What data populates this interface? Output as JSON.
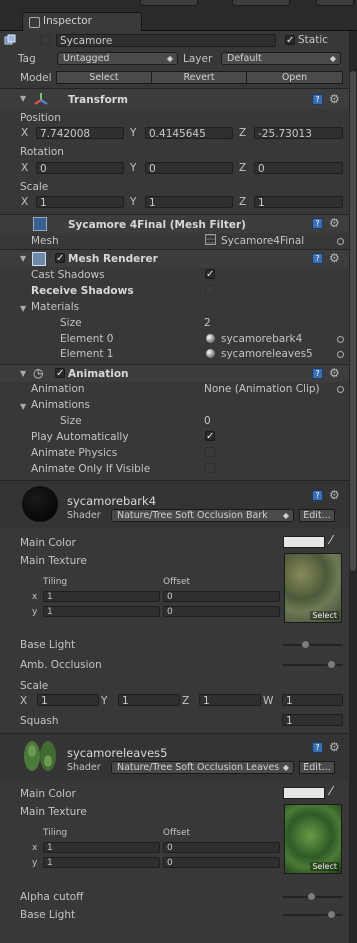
{
  "tab": {
    "title": "Inspector"
  },
  "object": {
    "name": "Sycamore",
    "static_label": "Static",
    "static_checked": true,
    "tag_label": "Tag",
    "tag_value": "Untagged",
    "layer_label": "Layer",
    "layer_value": "Default",
    "model_label": "Model",
    "model_select": "Select",
    "model_revert": "Revert",
    "model_open": "Open"
  },
  "transform": {
    "title": "Transform",
    "position_label": "Position",
    "rotation_label": "Rotation",
    "scale_label": "Scale",
    "axis_x": "X",
    "axis_y": "Y",
    "axis_z": "Z",
    "position": {
      "x": "7.742008",
      "y": "0.4145645",
      "z": "-25.73013"
    },
    "rotation": {
      "x": "0",
      "y": "0",
      "z": "0"
    },
    "scale": {
      "x": "1",
      "y": "1",
      "z": "1"
    }
  },
  "mesh_filter": {
    "title": "Sycamore 4Final (Mesh Filter)",
    "mesh_label": "Mesh",
    "mesh_value": "Sycamore4Final"
  },
  "mesh_renderer": {
    "title": "Mesh Renderer",
    "cast_shadows": "Cast Shadows",
    "receive_shadows": "Receive Shadows",
    "materials": "Materials",
    "size_label": "Size",
    "size": "2",
    "element0_label": "Element 0",
    "element0": "sycamorebark4",
    "element1_label": "Element 1",
    "element1": "sycamoreleaves5"
  },
  "animation": {
    "title": "Animation",
    "animation_label": "Animation",
    "animation_value": "None (Animation Clip)",
    "animations": "Animations",
    "size_label": "Size",
    "size": "0",
    "play_auto": "Play Automatically",
    "animate_physics": "Animate Physics",
    "animate_visible": "Animate Only If Visible"
  },
  "mat1": {
    "name": "sycamorebark4",
    "shader_label": "Shader",
    "shader": "Nature/Tree Soft Occlusion Bark",
    "edit": "Edit...",
    "main_color": "Main Color",
    "main_texture": "Main Texture",
    "tiling": "Tiling",
    "offset": "Offset",
    "ax_x": "x",
    "ax_y": "y",
    "tile_x": "1",
    "tile_y": "1",
    "off_x": "0",
    "off_y": "0",
    "select": "Select",
    "base_light": "Base Light",
    "amb_occlusion": "Amb. Occlusion",
    "scale_label": "Scale",
    "scale_x_label": "X",
    "scale_y_label": "Y",
    "scale_z_label": "Z",
    "scale_w_label": "W",
    "scale_x": "1",
    "scale_y": "1",
    "scale_z": "1",
    "scale_w": "1",
    "squash_label": "Squash",
    "squash": "1",
    "base_light_value": 0.4,
    "amb_occlusion_value": 0.85
  },
  "mat2": {
    "name": "sycamoreleaves5",
    "shader_label": "Shader",
    "shader": "Nature/Tree Soft Occlusion Leaves",
    "edit": "Edit...",
    "main_color": "Main Color",
    "main_texture": "Main Texture",
    "tiling": "Tiling",
    "offset": "Offset",
    "ax_x": "x",
    "ax_y": "y",
    "tile_x": "1",
    "tile_y": "1",
    "off_x": "0",
    "off_y": "0",
    "select": "Select",
    "alpha_cutoff": "Alpha cutoff",
    "base_light": "Base Light",
    "alpha_cutoff_value": 0.5,
    "base_light_value": 0.85
  },
  "colors": {
    "panel": "#383838",
    "header": "#3d3d3d",
    "field": "#2f2f2f",
    "help": "#3b6db0"
  }
}
